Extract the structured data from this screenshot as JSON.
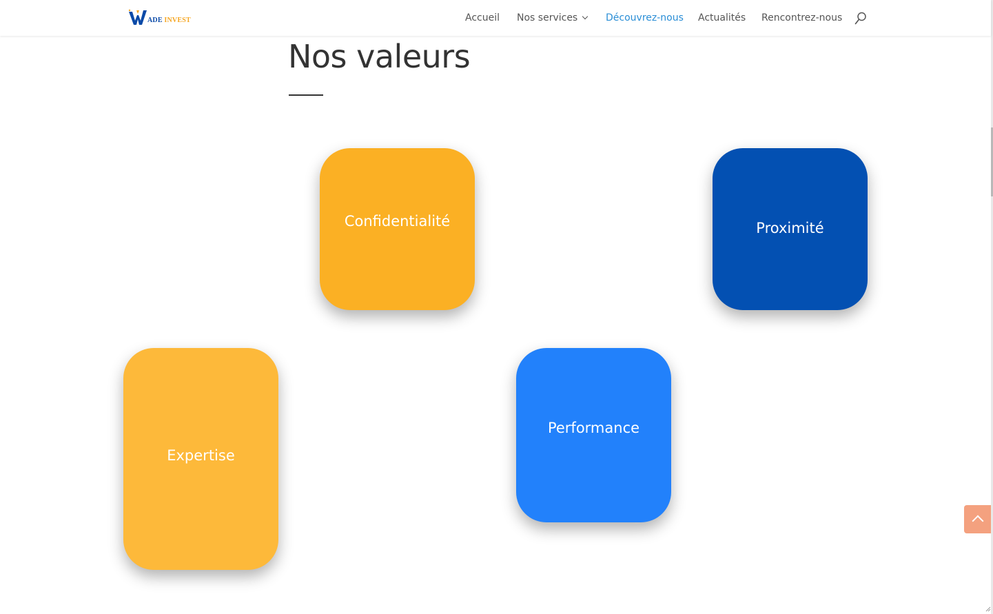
{
  "header": {
    "logo": {
      "letter": "W",
      "text_part1": "ADE",
      "text_part2": "INVEST"
    },
    "nav": [
      {
        "label": "Accueil",
        "active": false
      },
      {
        "label": "Nos services",
        "active": false,
        "has_dropdown": true
      },
      {
        "label": "Découvrez-nous",
        "active": true
      },
      {
        "label": "Actualités",
        "active": false
      },
      {
        "label": "Rencontrez-nous",
        "active": false
      }
    ],
    "search_icon": "search-icon"
  },
  "main": {
    "title": "Nos valeurs",
    "cards": [
      {
        "label": "Confidentialité",
        "color": "#fbb024"
      },
      {
        "label": "Proximité",
        "color": "#0350b2"
      },
      {
        "label": "Expertise",
        "color": "#fdb93a"
      },
      {
        "label": "Performance",
        "color": "#2281fb"
      }
    ]
  },
  "back_to_top": {
    "icon": "chevron-up-icon",
    "color": "#f4a17f"
  },
  "colors": {
    "nav_active": "#2a8ed6",
    "nav_text": "#555555",
    "title": "#333333"
  }
}
